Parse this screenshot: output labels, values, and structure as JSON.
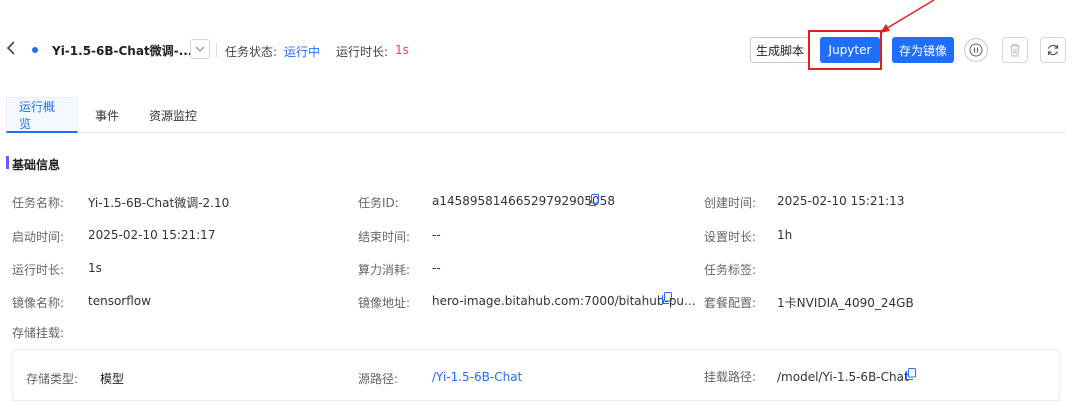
{
  "header": {
    "job_title": "Yi-1.5-6B-Chat微调-...",
    "status_label": "任务状态:",
    "status_value": "运行中",
    "duration_label": "运行时长:",
    "duration_value": "1s",
    "btn_generate": "生成脚本",
    "btn_jupyter": "Jupyter",
    "btn_save_image": "存为镜像"
  },
  "tabs": [
    "运行概览",
    "事件",
    "资源监控"
  ],
  "section_title": "基础信息",
  "info": {
    "task_name_label": "任务名称:",
    "task_name": "Yi-1.5-6B-Chat微调-2.10",
    "task_id_label": "任务ID:",
    "task_id": "a1458958146652979290505​8",
    "created_label": "创建时间:",
    "created": "2025-02-10 15:21:13",
    "start_label": "启动时间:",
    "start": "2025-02-10 15:21:17",
    "end_label": "结束时间:",
    "end": "--",
    "set_duration_label": "设置时长:",
    "set_duration": "1h",
    "run_duration_label": "运行时长:",
    "run_duration": "1s",
    "compute_label": "算力消耗:",
    "compute": "--",
    "task_tag_label": "任务标签:",
    "image_name_label": "镜像名称:",
    "image_name": "tensorflow",
    "image_addr_label": "镜像地址:",
    "image_addr": "hero-image.bitahub.com:7000/bitahub-pu...",
    "package_label": "套餐配置:",
    "package": "1卡NVIDIA_4090_24GB",
    "storage_label": "存储挂载:"
  },
  "storage": {
    "type_label": "存储类型:",
    "type": "模型",
    "source_label": "源路径:",
    "source": "/Yi-1.5-6B-Chat",
    "mount_label": "挂载路径:",
    "mount": "/model/Yi-1.5-6B-Chat"
  },
  "colors": {
    "accent": "#1f6fff",
    "highlight_frame": "#e0211b",
    "duration_value": "#e74c3c",
    "section_marker": "#6a5cff"
  }
}
